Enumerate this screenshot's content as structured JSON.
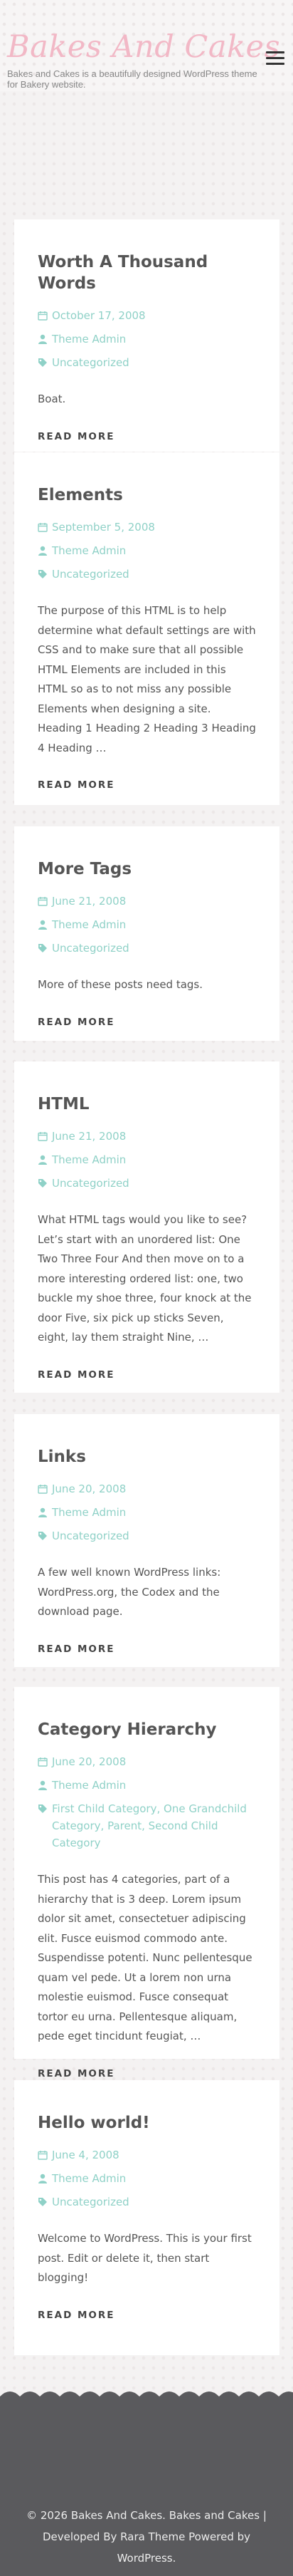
{
  "header": {
    "site_title": "Bakes And Cakes",
    "site_description": "Bakes and Cakes is a beautifully designed WordPress theme for Bakery website.",
    "menu_icon": "hamburger-menu-icon"
  },
  "posts": [
    {
      "title": "Worth A Thousand Words",
      "date": "October 17, 2008",
      "author": "Theme Admin",
      "categories": [
        "Uncategorized"
      ],
      "excerpt": "Boat.",
      "read_more": "READ MORE"
    },
    {
      "title": "Elements",
      "date": "September 5, 2008",
      "author": "Theme Admin",
      "categories": [
        "Uncategorized"
      ],
      "excerpt": "The purpose of this HTML is to help determine what default settings are with CSS and to make sure that all possible HTML Elements are included in this HTML so as to not miss any possible Elements when designing a site. Heading 1 Heading 2 Heading 3 Heading 4 Heading …",
      "read_more": "READ MORE"
    },
    {
      "title": "More Tags",
      "date": "June 21, 2008",
      "author": "Theme Admin",
      "categories": [
        "Uncategorized"
      ],
      "excerpt": "More of these posts need tags.",
      "read_more": "READ MORE"
    },
    {
      "title": "HTML",
      "date": "June 21, 2008",
      "author": "Theme Admin",
      "categories": [
        "Uncategorized"
      ],
      "excerpt": "What HTML tags would you like to see? Let’s start with an unordered list: One Two Three Four And then move on to a more interesting ordered list: one, two buckle my shoe three, four knock at the door Five, six pick up sticks Seven, eight, lay them straight Nine, …",
      "read_more": "READ MORE"
    },
    {
      "title": "Links",
      "date": "June 20, 2008",
      "author": "Theme Admin",
      "categories": [
        "Uncategorized"
      ],
      "excerpt": "A few well known WordPress links: WordPress.org, the Codex and the download page.",
      "read_more": "READ MORE"
    },
    {
      "title": "Category Hierarchy",
      "date": "June 20, 2008",
      "author": "Theme Admin",
      "categories": [
        "First Child Category",
        "One Grandchild Category",
        "Parent",
        "Second Child Category"
      ],
      "excerpt": "This post has 4 categories, part of a hierarchy that is 3 deep. Lorem ipsum dolor sit amet, consectetuer adipiscing elit. Fusce euismod commodo ante. Suspendisse potenti. Nunc pellentesque quam vel pede. Ut a lorem non urna molestie euismod. Fusce consequat tortor eu urna. Pellentesque aliquam, pede eget tincidunt feugiat, …",
      "read_more": "READ MORE"
    },
    {
      "title": "Hello world!",
      "date": "June 4, 2008",
      "author": "Theme Admin",
      "categories": [
        "Uncategorized"
      ],
      "excerpt": "Welcome to WordPress. This is your first post. Edit or delete it, then start blogging!",
      "read_more": "READ MORE"
    }
  ],
  "icons": {
    "date": "calendar-icon",
    "author": "user-icon",
    "category": "tag-icon"
  },
  "colors": {
    "accent": "#8fd1c7",
    "title_pink": "#f2b8c6",
    "footer_bg": "#5a5a5d",
    "card_bg": "#ffffff"
  },
  "footer": {
    "copyright": "© 2026 Bakes And Cakes.",
    "theme_name": "Bakes and Cakes",
    "separator": "|",
    "developed_by": "Developed By",
    "developer": "Rara Theme",
    "powered_by": "Powered by",
    "platform": "WordPress."
  }
}
